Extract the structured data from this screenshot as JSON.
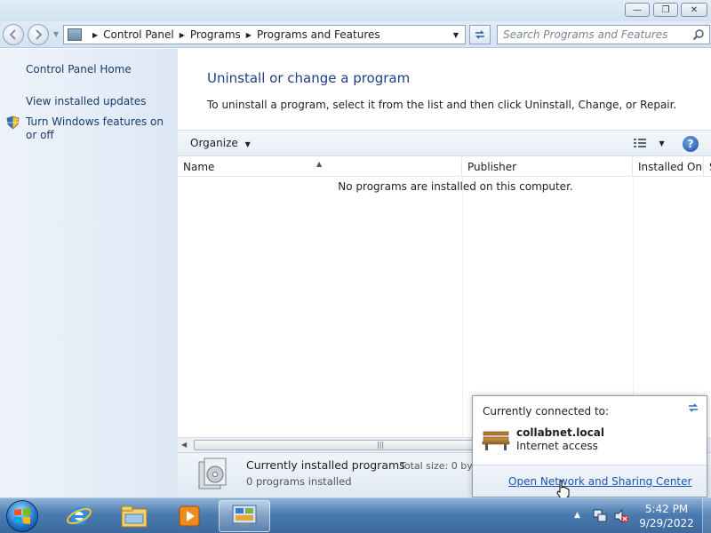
{
  "window": {
    "minimize_glyph": "—",
    "maximize_glyph": "❐",
    "close_glyph": "✕"
  },
  "address": {
    "crumbs": [
      "Control Panel",
      "Programs",
      "Programs and Features"
    ],
    "search_placeholder": "Search Programs and Features"
  },
  "sidebar": {
    "home": "Control Panel Home",
    "updates": "View installed updates",
    "features": "Turn Windows features on or off"
  },
  "main": {
    "title": "Uninstall or change a program",
    "description": "To uninstall a program, select it from the list and then click Uninstall, Change, or Repair.",
    "organize_label": "Organize",
    "help_glyph": "?",
    "columns": [
      "Name",
      "Publisher",
      "Installed On",
      "S"
    ],
    "empty_message": "No programs are installed on this computer."
  },
  "details": {
    "title": "Currently installed programs",
    "total_size": "Total size: 0 byt",
    "count": "0 programs installed"
  },
  "network_flyout": {
    "heading": "Currently connected to:",
    "network_name": "collabnet.local",
    "access": "Internet access",
    "link": "Open Network and Sharing Center"
  },
  "taskbar": {
    "time": "5:42 PM",
    "date": "9/29/2022",
    "items": [
      "internet-explorer-icon",
      "windows-explorer-icon",
      "media-player-icon",
      "control-panel-icon"
    ]
  },
  "colors": {
    "title_blue": "#1e3f88",
    "link_blue": "#1a55b3",
    "taskbar": "#4b7bb0"
  }
}
